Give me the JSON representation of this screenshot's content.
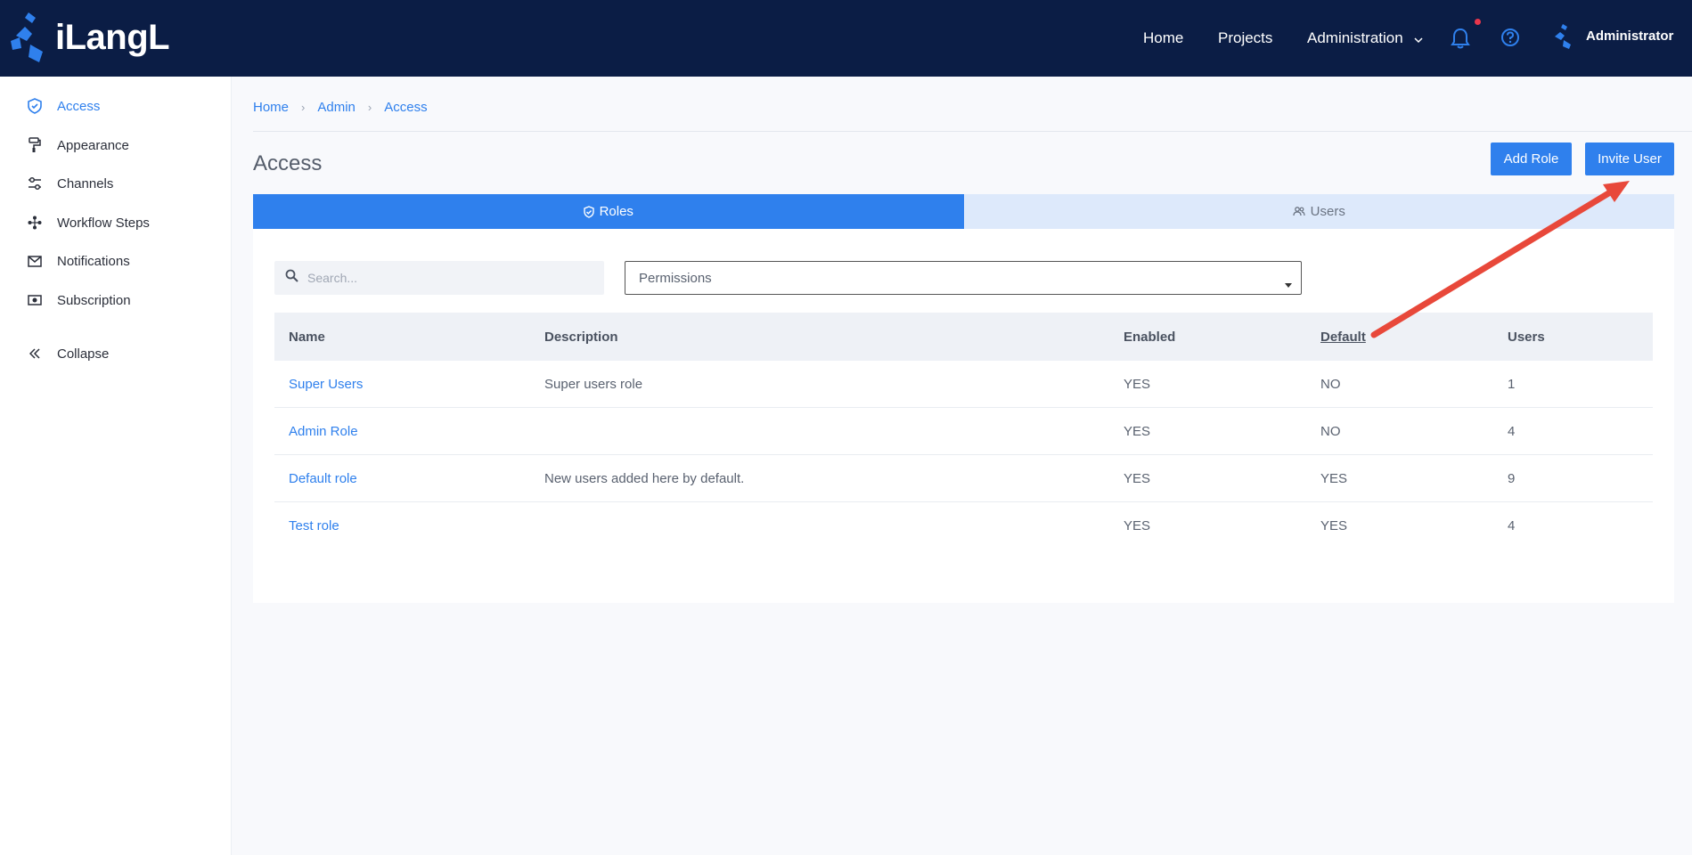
{
  "app": {
    "logo_text": "iLangL"
  },
  "topnav": {
    "home": "Home",
    "projects": "Projects",
    "administration": "Administration",
    "user_name": "Administrator"
  },
  "sidebar": {
    "items": [
      {
        "label": "Access",
        "icon": "shield-check-icon",
        "active": true
      },
      {
        "label": "Appearance",
        "icon": "paint-roller-icon"
      },
      {
        "label": "Channels",
        "icon": "sliders-icon"
      },
      {
        "label": "Workflow Steps",
        "icon": "workflow-icon"
      },
      {
        "label": "Notifications",
        "icon": "envelope-icon"
      },
      {
        "label": "Subscription",
        "icon": "money-icon"
      },
      {
        "label": "Collapse",
        "icon": "double-chevron-left-icon"
      }
    ]
  },
  "breadcrumb": [
    "Home",
    "Admin",
    "Access"
  ],
  "page": {
    "title": "Access",
    "add_role": "Add Role",
    "invite_user": "Invite User"
  },
  "tabs": [
    {
      "label": "Roles",
      "active": true
    },
    {
      "label": "Users",
      "active": false
    }
  ],
  "filters": {
    "search_placeholder": "Search...",
    "permissions_value": "Permissions"
  },
  "table": {
    "columns": [
      "Name",
      "Description",
      "Enabled",
      "Default",
      "Users"
    ],
    "rows": [
      {
        "name": "Super Users",
        "description": "Super users role",
        "enabled": "YES",
        "default": "NO",
        "users": "1"
      },
      {
        "name": "Admin Role",
        "description": "",
        "enabled": "YES",
        "default": "NO",
        "users": "4"
      },
      {
        "name": "Default role",
        "description": "New users added here by default.",
        "enabled": "YES",
        "default": "YES",
        "users": "9"
      },
      {
        "name": "Test role",
        "description": "",
        "enabled": "YES",
        "default": "YES",
        "users": "4"
      }
    ]
  },
  "colors": {
    "topbar": "#0b1d45",
    "accent": "#2f80ed",
    "annotation_arrow": "#e8483a"
  }
}
